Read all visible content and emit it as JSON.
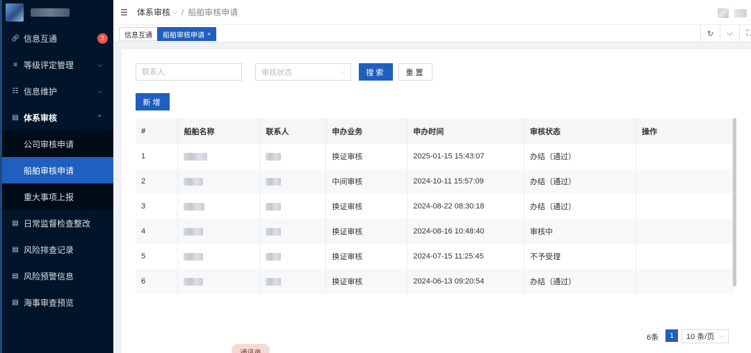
{
  "sidebar": {
    "menu": [
      {
        "label": "信息互通",
        "icon": "link-icon",
        "badge": "3"
      },
      {
        "label": "等级评定管理",
        "icon": "level-icon"
      },
      {
        "label": "信息维护",
        "icon": "org-icon"
      },
      {
        "label": "体系审核",
        "icon": "audit-icon"
      },
      {
        "label": "日常监督检查整改",
        "icon": "doc-check-icon"
      },
      {
        "label": "风险排查记录",
        "icon": "doc-check-icon"
      },
      {
        "label": "风险预警信息",
        "icon": "doc-check-icon"
      },
      {
        "label": "海事审查预览",
        "icon": "doc-check-icon"
      }
    ],
    "submenu": [
      {
        "label": "公司审核申请"
      },
      {
        "label": "船舶审核申请"
      },
      {
        "label": "重大事项上报"
      }
    ]
  },
  "header": {
    "breadcrumb_parent": "体系审核",
    "breadcrumb_current": "船舶审核申请"
  },
  "tabs": [
    {
      "label": "信息互通"
    },
    {
      "label": "船舶审核申请",
      "close": "×"
    }
  ],
  "filters": {
    "contact_placeholder": "联系人",
    "status_placeholder": "审核状态",
    "search_label": "搜索",
    "reset_label": "重置",
    "add_label": "新增"
  },
  "table": {
    "columns": [
      "#",
      "船舶名称",
      "联系人",
      "申办业务",
      "申办时间",
      "审核状态",
      "操作"
    ],
    "rows": [
      {
        "no": "1",
        "business": "换证审核",
        "time": "2025-01-15 15:43:07",
        "status": "办结（通过）"
      },
      {
        "no": "2",
        "business": "中间审核",
        "time": "2024-10-11 15:57:09",
        "status": "办结（通过）"
      },
      {
        "no": "3",
        "business": "换证审核",
        "time": "2024-08-22 08:30:18",
        "status": "办结（通过）"
      },
      {
        "no": "4",
        "business": "换证审核",
        "time": "2024-08-16 10:48:40",
        "status": "审核中"
      },
      {
        "no": "5",
        "business": "换证审核",
        "time": "2024-07-15 11:25:45",
        "status": "不予受理"
      },
      {
        "no": "6",
        "business": "换证审核",
        "time": "2024-06-13 09:20:54",
        "status": "办结（通过）"
      }
    ]
  },
  "pagination": {
    "total": "6条",
    "current_page": "1",
    "page_size": "10 条/页"
  },
  "floating": {
    "label": "通讯录"
  },
  "colors": {
    "sidebar_bg": "#001529",
    "primary": "#1f5fbf",
    "badge": "#f0524d"
  }
}
